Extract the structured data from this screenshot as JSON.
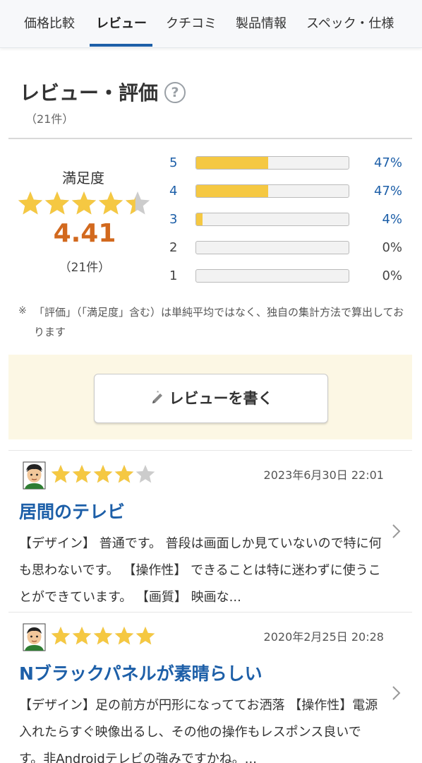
{
  "tabs": [
    {
      "label": "価格比較"
    },
    {
      "label": "レビュー"
    },
    {
      "label": "クチコミ"
    },
    {
      "label": "製品情報"
    },
    {
      "label": "スペック・仕様"
    }
  ],
  "section": {
    "title": "レビュー・評価",
    "help_icon": "question-circle-icon",
    "count": "（21件）"
  },
  "satisfaction": {
    "label": "満足度",
    "score": "4.41",
    "rating_value": 4.41,
    "count": "（21件）"
  },
  "distribution": [
    {
      "star": "5",
      "percent": "47%",
      "fraction": 0.47,
      "linked": true
    },
    {
      "star": "4",
      "percent": "47%",
      "fraction": 0.47,
      "linked": true
    },
    {
      "star": "3",
      "percent": "4%",
      "fraction": 0.04,
      "linked": true
    },
    {
      "star": "2",
      "percent": "0%",
      "fraction": 0,
      "linked": false
    },
    {
      "star": "1",
      "percent": "0%",
      "fraction": 0,
      "linked": false
    }
  ],
  "note": {
    "mark": "※",
    "text": "「評価」（「満足度」含む）は単純平均ではなく、独自の集計方法で算出しております"
  },
  "write_button": {
    "label": "レビューを書く",
    "icon": "pencil-icon"
  },
  "reviews": [
    {
      "stars": 4,
      "date": "2023年6月30日 22:01",
      "title": "居間のテレビ",
      "body": "【デザイン】 普通です。 普段は画面しか見ていないので特に何も思わないです。 【操作性】 できることは特に迷わずに使うことができています。 【画質】 映画な..."
    },
    {
      "stars": 5,
      "date": "2020年2月25日 20:28",
      "title": "Nブラックパネルが素晴らしい",
      "body": "【デザイン】足の前方が円形になっててお洒落 【操作性】電源入れたらすぐ映像出るし、その他の操作もレスポンス良いです。非Androidテレビの強みですかね。..."
    }
  ],
  "colors": {
    "accent": "#1d5fa8",
    "star": "#f5c842",
    "star_empty": "#cccccc",
    "score": "#d2691e",
    "write_bg": "#fcf7e4"
  }
}
